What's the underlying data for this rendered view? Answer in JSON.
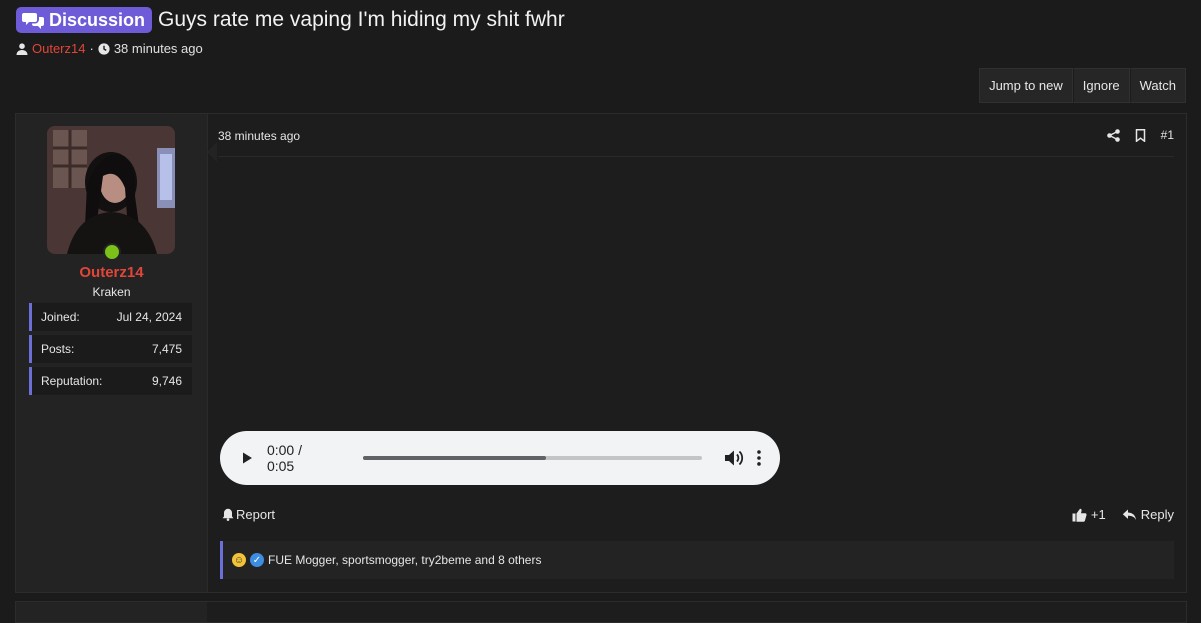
{
  "thread": {
    "prefix": "Discussion",
    "title": "Guys rate me vaping I'm hiding my shit fwhr",
    "author": "Outerz14",
    "separator": "·",
    "time": "38 minutes ago"
  },
  "actions": {
    "jump": "Jump to new",
    "ignore": "Ignore",
    "watch": "Watch"
  },
  "post": {
    "date": "38 minutes ago",
    "number": "#1",
    "user": {
      "name": "Outerz14",
      "title": "Kraken",
      "stats": [
        {
          "label": "Joined:",
          "value": "Jul 24, 2024"
        },
        {
          "label": "Posts:",
          "value": "7,475"
        },
        {
          "label": "Reputation:",
          "value": "9,746"
        }
      ]
    },
    "audio": {
      "time": "0:00 / 0:05",
      "progress": 0.54
    },
    "report": "Report",
    "like_count": "+1",
    "reply": "Reply",
    "reactions_text": "FUE Mogger, sportsmogger, try2beme and 8 others"
  },
  "colors": {
    "accent": "#6d5bd8",
    "username": "#e0463a",
    "online": "#7bc11a"
  }
}
